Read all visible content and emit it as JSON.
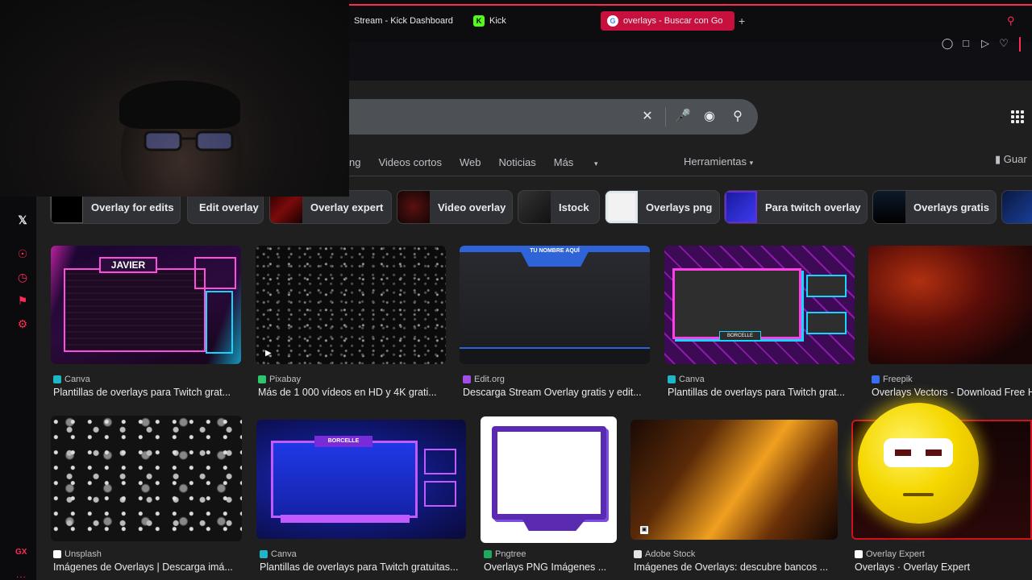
{
  "browser": {
    "tabs": [
      {
        "label": "Stream - Kick Dashboard"
      },
      {
        "label": "Kick"
      },
      {
        "label": "overlays - Buscar con Go"
      }
    ],
    "new_tab_label": "+"
  },
  "search": {
    "query": ""
  },
  "nav": {
    "tabs": [
      "ng",
      "Videos cortos",
      "Web",
      "Noticias",
      "Más"
    ],
    "tools_label": "Herramientas",
    "save_label": "Guar"
  },
  "chips": [
    {
      "label": "Overlay for edits"
    },
    {
      "label": "Edit overlay"
    },
    {
      "label": "Overlay expert"
    },
    {
      "label": "Video overlay"
    },
    {
      "label": "Istock"
    },
    {
      "label": "Overlays png"
    },
    {
      "label": "Para twitch overlay"
    },
    {
      "label": "Overlays gratis"
    }
  ],
  "results_row1": [
    {
      "source": "Canva",
      "title": "Plantillas de overlays para Twitch grat...",
      "img_text": "JAVIER"
    },
    {
      "source": "Pixabay",
      "title": "Más de 1 000 vídeos en HD y 4K grati..."
    },
    {
      "source": "Edit.org",
      "title": "Descarga Stream Overlay gratis y edit...",
      "img_text": "TU NOMBRE AQUÍ"
    },
    {
      "source": "Canva",
      "title": "Plantillas de overlays para Twitch grat...",
      "img_text": "BORCELLE"
    },
    {
      "source": "Freepik",
      "title": "Overlays Vectors - Download Free H"
    }
  ],
  "results_row2": [
    {
      "source": "Unsplash",
      "title": "Imágenes de Overlays | Descarga imá..."
    },
    {
      "source": "Canva",
      "title": "Plantillas de overlays para Twitch gratuitas...",
      "img_text": "BORCELLE"
    },
    {
      "source": "Pngtree",
      "title": "Overlays PNG Imágenes ..."
    },
    {
      "source": "Adobe Stock",
      "title": "Imágenes de Overlays: descubre bancos ..."
    },
    {
      "source": "Overlay Expert",
      "title": "Overlays · Overlay Expert"
    }
  ],
  "sidebar": {
    "gx_label": "GX",
    "more_label": "..."
  },
  "colors": {
    "accent": "#ff2b55",
    "page_bg": "#1f1f1f",
    "chip_bg": "#303134"
  }
}
